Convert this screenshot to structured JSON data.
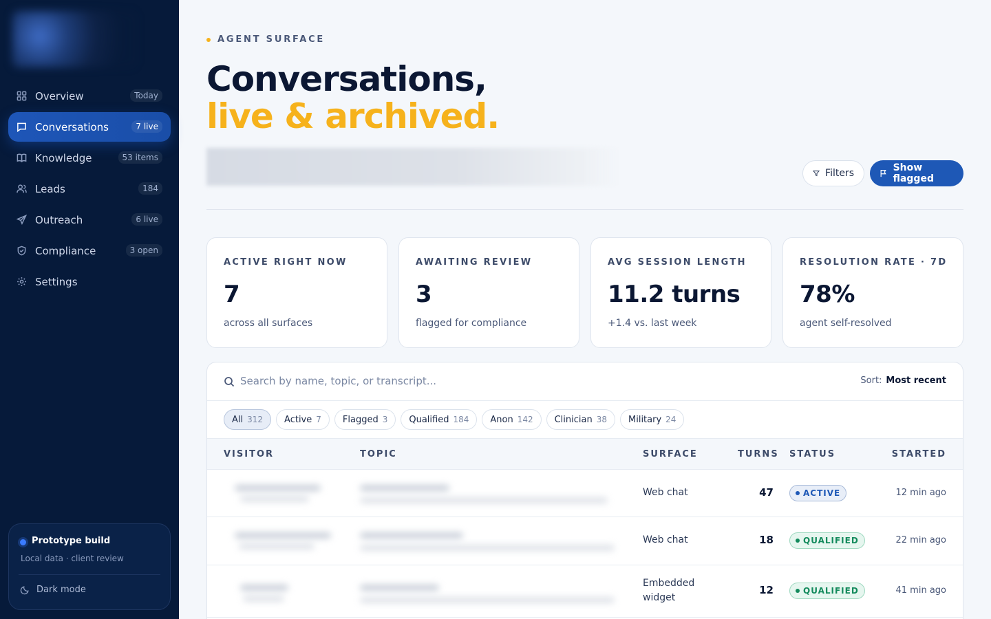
{
  "sidebar": {
    "items": [
      {
        "label": "Overview",
        "badge": "Today",
        "icon": "grid-icon"
      },
      {
        "label": "Conversations",
        "badge": "7 live",
        "icon": "chat-icon"
      },
      {
        "label": "Knowledge",
        "badge": "53 items",
        "icon": "book-icon"
      },
      {
        "label": "Leads",
        "badge": "184",
        "icon": "users-icon"
      },
      {
        "label": "Outreach",
        "badge": "6 live",
        "icon": "send-icon"
      },
      {
        "label": "Compliance",
        "badge": "3 open",
        "icon": "shield-icon"
      },
      {
        "label": "Settings",
        "badge": "",
        "icon": "gear-icon"
      }
    ],
    "prototype": {
      "title": "Prototype build",
      "subtitle": "Local data · client review",
      "dark_mode": "Dark mode"
    }
  },
  "header": {
    "eyebrow": "AGENT SURFACE",
    "title_line1": "Conversations,",
    "title_line2": "live & archived.",
    "filters_label": "Filters",
    "flagged_label": "Show flagged"
  },
  "stats": [
    {
      "label": "ACTIVE RIGHT NOW",
      "value": "7",
      "note": "across all surfaces"
    },
    {
      "label": "AWAITING REVIEW",
      "value": "3",
      "note": "flagged for compliance"
    },
    {
      "label": "AVG SESSION LENGTH",
      "value": "11.2 turns",
      "note": "+1.4 vs. last week"
    },
    {
      "label": "RESOLUTION RATE · 7D",
      "value": "78%",
      "note": "agent self-resolved"
    }
  ],
  "search": {
    "placeholder": "Search by name, topic, or transcript...",
    "sort_label": "Sort:",
    "sort_value": "Most recent"
  },
  "chips": [
    {
      "label": "All",
      "count": "312"
    },
    {
      "label": "Active",
      "count": "7"
    },
    {
      "label": "Flagged",
      "count": "3"
    },
    {
      "label": "Qualified",
      "count": "184"
    },
    {
      "label": "Anon",
      "count": "142"
    },
    {
      "label": "Clinician",
      "count": "38"
    },
    {
      "label": "Military",
      "count": "24"
    }
  ],
  "table": {
    "headers": {
      "visitor": "VISITOR",
      "topic": "TOPIC",
      "surface": "SURFACE",
      "turns": "TURNS",
      "status": "STATUS",
      "started": "STARTED"
    },
    "rows": [
      {
        "surface": "Web chat",
        "turns": "47",
        "status": "ACTIVE",
        "started": "12 min ago"
      },
      {
        "surface": "Web chat",
        "turns": "18",
        "status": "QUALIFIED",
        "started": "22 min ago"
      },
      {
        "surface": "Embedded widget",
        "turns": "12",
        "status": "QUALIFIED",
        "started": "41 min ago"
      }
    ]
  },
  "colors": {
    "accent": "#1e58b6",
    "highlight": "#f6b21c",
    "sidebar": "#061a3a"
  }
}
